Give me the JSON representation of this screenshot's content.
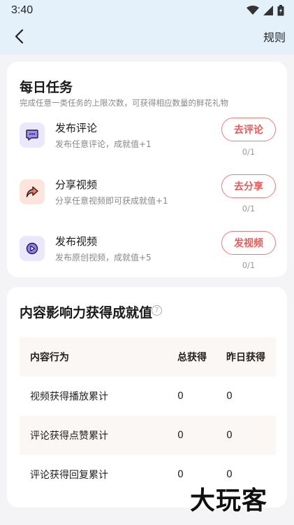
{
  "status_bar": {
    "time": "3:40"
  },
  "nav": {
    "right_link": "规则"
  },
  "daily_tasks": {
    "title": "每日任务",
    "subtitle": "完成任意一类任务的上限次数，可获得相应数量的鲜花礼物",
    "tasks": [
      {
        "name": "发布评论",
        "desc": "发布任意评论，成就值+1",
        "button": "去评论",
        "progress": "0/1",
        "icon": "comment-icon",
        "icon_color": "#9b8cff",
        "icon_bg": "#ebe7ff"
      },
      {
        "name": "分享视频",
        "desc": "分享任意视频即可获成就值+1",
        "button": "去分享",
        "progress": "0/1",
        "icon": "share-icon",
        "icon_color": "#f07a68",
        "icon_bg": "#ffe3dd"
      },
      {
        "name": "发布视频",
        "desc": "发布原创视频，成就值+5",
        "button": "发视频",
        "progress": "0/1",
        "icon": "video-icon",
        "icon_color": "#8f7dff",
        "icon_bg": "#ebe7ff"
      }
    ]
  },
  "influence": {
    "title": "内容影响力获得成就值",
    "columns": [
      "内容行为",
      "总获得",
      "昨日获得"
    ],
    "rows": [
      [
        "视频获得播放累计",
        "0",
        "0"
      ],
      [
        "评论获得点赞累计",
        "0",
        "0"
      ],
      [
        "评论获得回复累计",
        "0",
        "0"
      ]
    ]
  },
  "watermark": "大玩客",
  "colors": {
    "accent": "#e85a5a",
    "header_bg": "#e4f1fb",
    "page_bg": "#f4f4f6"
  }
}
